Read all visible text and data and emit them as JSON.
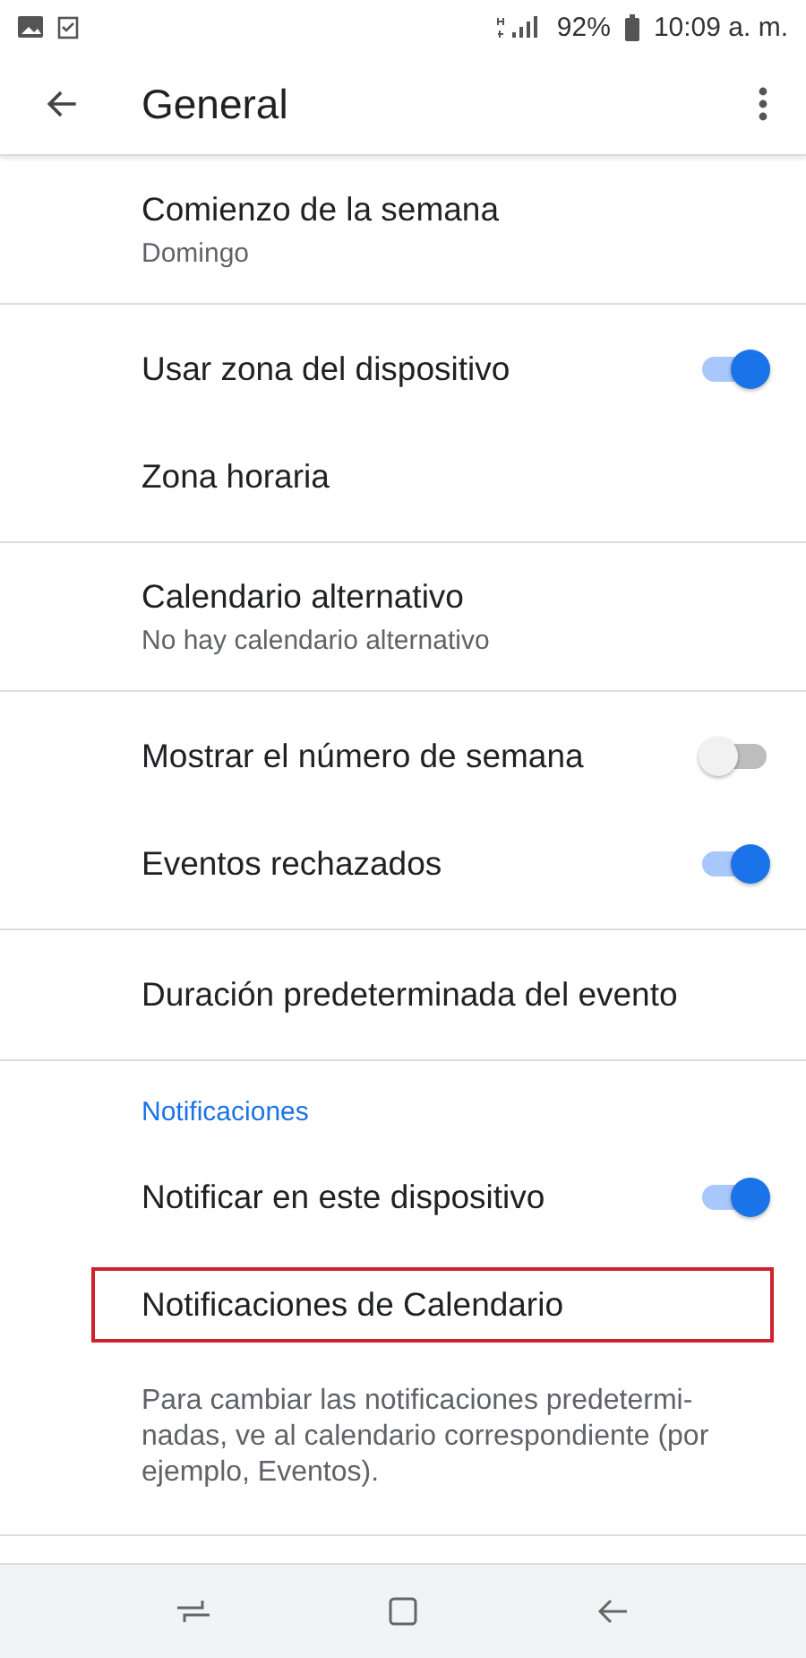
{
  "status_bar": {
    "battery": "92%",
    "time": "10:09 a. m."
  },
  "app_bar": {
    "title": "General"
  },
  "sections": [
    {
      "items": [
        {
          "kind": "text",
          "title": "Comienzo de la semana",
          "subtitle": "Domingo"
        }
      ]
    },
    {
      "items": [
        {
          "kind": "toggle",
          "title": "Usar zona del dispositivo",
          "on": true
        },
        {
          "kind": "text",
          "title": "Zona horaria"
        }
      ]
    },
    {
      "items": [
        {
          "kind": "text",
          "title": "Calendario alternativo",
          "subtitle": "No hay calendario alternativo"
        }
      ]
    },
    {
      "items": [
        {
          "kind": "toggle",
          "title": "Mostrar el número de semana",
          "on": false
        },
        {
          "kind": "toggle",
          "title": "Eventos rechazados",
          "on": true
        }
      ]
    },
    {
      "items": [
        {
          "kind": "text",
          "title": "Duración predeterminada del evento"
        }
      ]
    },
    {
      "items": [
        {
          "kind": "header",
          "title": "Notificaciones"
        },
        {
          "kind": "toggle",
          "title": "Notificar en este dispositivo",
          "on": true
        },
        {
          "kind": "text",
          "title": "Notificaciones de Calendario",
          "highlighted": true
        },
        {
          "kind": "note",
          "title": "Para cambiar las notificaciones predetermi-nadas, ve al calendario correspondiente (por ejemplo, Eventos)."
        }
      ]
    }
  ]
}
